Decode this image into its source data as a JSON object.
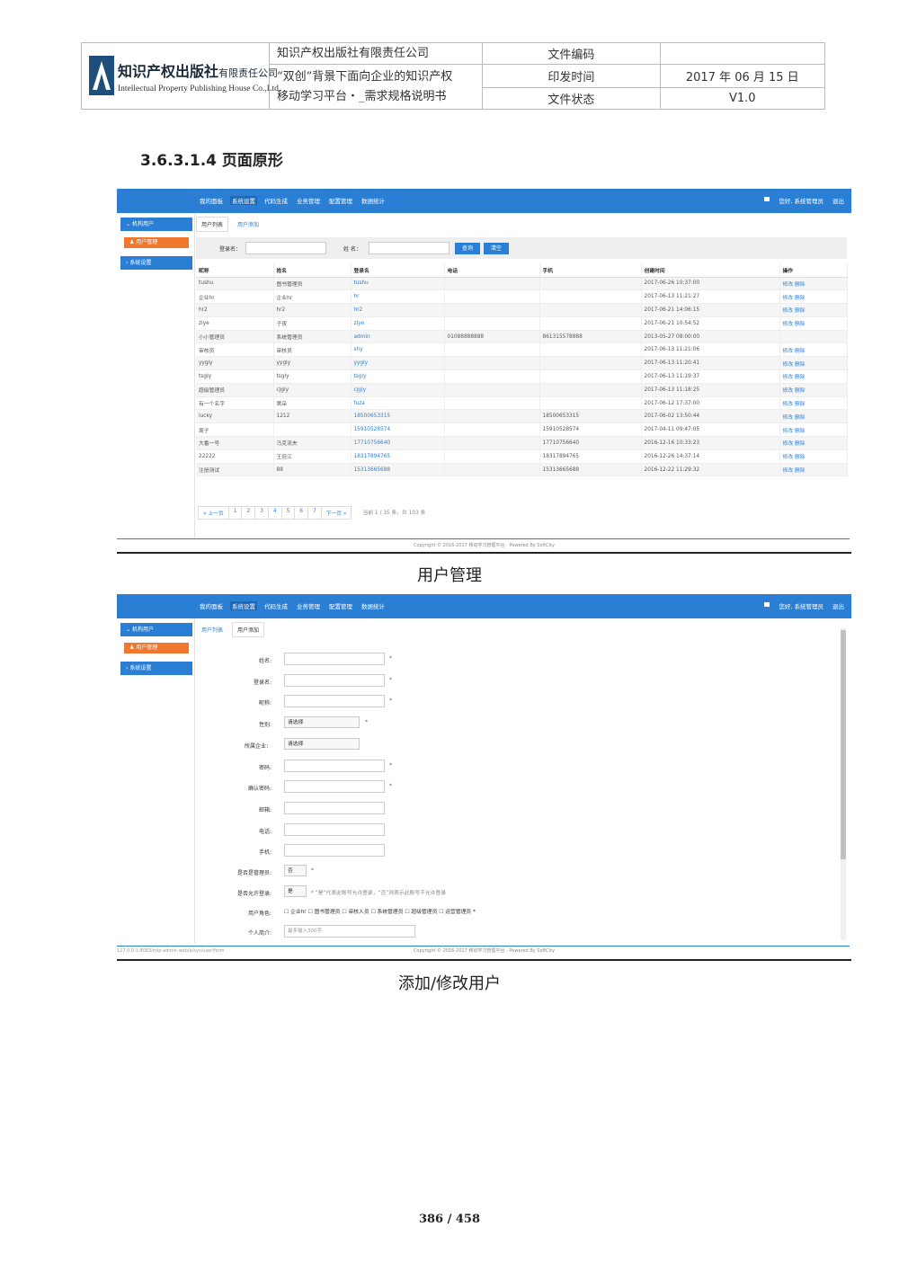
{
  "header": {
    "logo": {
      "cn": "知识产权出版社",
      "cn_suffix": "有限责任公司",
      "en": "Intellectual Property Publishing House Co.,Ltd."
    },
    "org": "知识产权出版社有限责任公司",
    "doc_title_line1": "“双创”背景下面向企业的知识产权",
    "doc_title_line2": "移动学习平台・_需求规格说明书",
    "labels": {
      "code": "文件编码",
      "date": "印发时间",
      "status": "文件状态"
    },
    "values": {
      "code": "",
      "date": "2017 年 06 月 15 日",
      "status": "V1.0"
    }
  },
  "section_heading": "3.6.3.1.4 页面原形",
  "app": {
    "nav": [
      "我的面板",
      "系统设置",
      "代码生成",
      "业务管理",
      "配置管理",
      "数据统计"
    ],
    "nav_active_index": 1,
    "greeting": "您好, 系统管理员",
    "logout": "退出",
    "sidebar": {
      "group1": "机构用户",
      "sub1": "用户管理",
      "group2": "系统设置"
    },
    "tabs": [
      "用户列表",
      "用户添加"
    ],
    "footer": "Copyright © 2016-2017 移动学习管理平台 - Powered By SoftCity",
    "accent": "#2a7fd4",
    "orange": "#f0772e"
  },
  "list_page": {
    "search": {
      "login_label": "登录名：",
      "name_label": "姓  名：",
      "query_btn": "查询",
      "clear_btn": "清空"
    },
    "columns": [
      "昵称",
      "姓名",
      "登录名",
      "电话",
      "手机",
      "创建时间",
      "操作"
    ],
    "rows": [
      [
        "tushu",
        "图书管理员",
        "tushu",
        "",
        "",
        "2017-06-26 10:37:00",
        "修改 删除"
      ],
      [
        "企业hr",
        "企业hr",
        "hr",
        "",
        "",
        "2017-06-13 11:21:27",
        "修改 删除"
      ],
      [
        "hr2",
        "hr2",
        "hr2",
        "",
        "",
        "2017-06-21 14:06:15",
        "修改 删除"
      ],
      [
        "ziye",
        "子夜",
        "ziye",
        "",
        "",
        "2017-06-21 10:54:52",
        "修改 删除"
      ],
      [
        "小小管理员",
        "系统管理员",
        "admin",
        "01088888888",
        "861315578888",
        "2013-05-27 08:00:00",
        ""
      ],
      [
        "审核员",
        "审核员",
        "shy",
        "",
        "",
        "2017-06-13 11:21:06",
        "修改 删除"
      ],
      [
        "yygly",
        "yygly",
        "yygly",
        "",
        "",
        "2017-06-13 11:20:41",
        "修改 删除"
      ],
      [
        "tsgly",
        "tsgly",
        "tsgly",
        "",
        "",
        "2017-06-13 11:19:37",
        "修改 删除"
      ],
      [
        "超级管理员",
        "cjgly",
        "cjgly",
        "",
        "",
        "2017-06-13 11:18:25",
        "修改 删除"
      ],
      [
        "有一个名字",
        "窝朵",
        "fuza",
        "",
        "",
        "2017-06-12 17:37:00",
        "修改 删除"
      ],
      [
        "lucky",
        "1212",
        "18500653315",
        "",
        "18500653315",
        "2017-06-02 13:50:44",
        "修改 删除"
      ],
      [
        "周子",
        "",
        "15910528574",
        "",
        "15910528574",
        "2017-04-11 09:47:05",
        "修改 删除"
      ],
      [
        "大番一号",
        "马克流夫",
        "17710756640",
        "",
        "17710756640",
        "2016-12-16 10:33:23",
        "修改 删除"
      ],
      [
        "22222",
        "王倍江",
        "18317894765",
        "",
        "18317894765",
        "2016-12-26 14:37:14",
        "修改 删除"
      ],
      [
        "注册测试",
        "88",
        "15313665688",
        "",
        "15313665688",
        "2016-12-22 11:29:32",
        "修改 删除"
      ]
    ],
    "pager": [
      "« 上一页",
      "1",
      "2",
      "3",
      "4",
      "5",
      "6",
      "7",
      "下一页 »"
    ],
    "pager_info": "当前  1  /  15  条，共 103 条",
    "caption": "用户管理"
  },
  "form_page": {
    "fields": [
      {
        "label": "姓名:",
        "type": "text",
        "required": "*"
      },
      {
        "label": "登录名:",
        "type": "text",
        "required": "*"
      },
      {
        "label": "昵称:",
        "type": "text",
        "required": "*"
      },
      {
        "label": "性别:",
        "type": "select",
        "value": "请选择",
        "required": "*"
      },
      {
        "label": "所属企业：",
        "type": "select",
        "value": "请选择",
        "required": ""
      },
      {
        "label": "密码:",
        "type": "text",
        "required": "*"
      },
      {
        "label": "确认密码:",
        "type": "text",
        "required": "*"
      },
      {
        "label": "邮箱:",
        "type": "text",
        "required": ""
      },
      {
        "label": "电话:",
        "type": "text",
        "required": ""
      },
      {
        "label": "手机:",
        "type": "text",
        "required": ""
      }
    ],
    "is_admin": {
      "label": "是否是管理员:",
      "value": "否",
      "required": "*"
    },
    "allow_login": {
      "label": "是否允许登录:",
      "value": "是",
      "hint": "* “是”代表此账号允许登录，“否”则表示此账号不允许登录"
    },
    "roles": {
      "label": "用户角色:",
      "options": "☐ 企业hr ☐ 图书管理员 ☐ 审核人员 ☐ 系统管理员 ☐ 超级管理员 ☐ 运营管理员",
      "required": "*"
    },
    "intro": {
      "label": "个人简介:",
      "placeholder": "最多输入300字"
    },
    "status_url": "127.0.0.1:8083/mlp-admin-web/a/sys/user/form",
    "caption": "添加/修改用户"
  },
  "page_number": "386 / 458"
}
